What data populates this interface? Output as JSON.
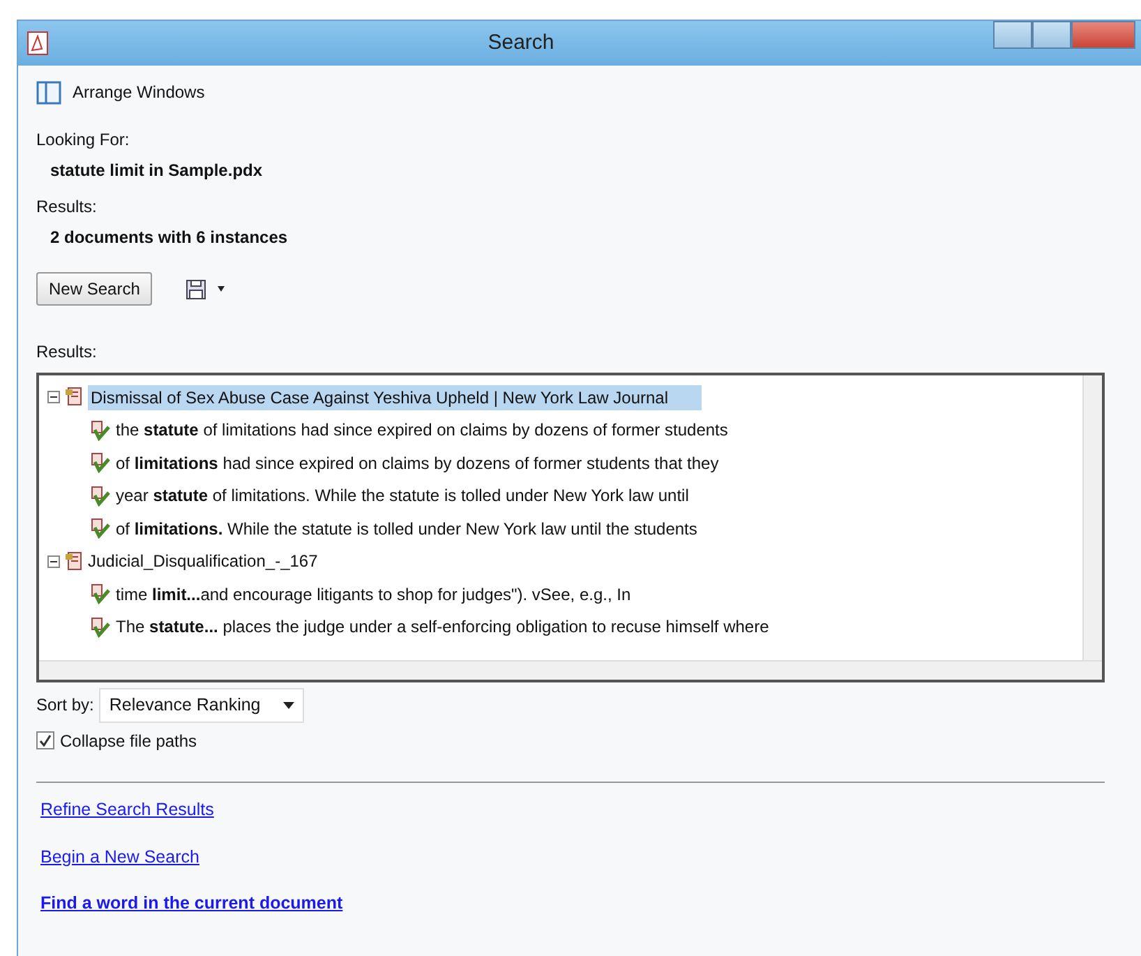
{
  "window": {
    "title": "Search"
  },
  "toolbar": {
    "arrange_label": "Arrange Windows"
  },
  "looking_for": {
    "label": "Looking For:",
    "value": "statute limit in Sample.pdx"
  },
  "summary": {
    "label": "Results:",
    "value": "2 documents with 6 instances"
  },
  "new_search_button": "New Search",
  "results_label": "Results:",
  "results": [
    {
      "title": "Dismissal of Sex Abuse Case Against Yeshiva Upheld | New York Law Journal",
      "expanded": true,
      "selected": true,
      "children": [
        {
          "text": "the **statute** of limitations had since expired on claims by dozens of former students"
        },
        {
          "text": "of **limitations** had since expired on claims by dozens of former students that they"
        },
        {
          "text": "year **statute** of limitations. While the statute is tolled under New York law until"
        },
        {
          "text": "of **limitations.** While the statute is tolled under New York law until the students"
        }
      ]
    },
    {
      "title": "Judicial_Disqualification_-_167",
      "expanded": true,
      "selected": false,
      "children": [
        {
          "text": "time **limit...**and encourage litigants to shop for judges\"). vSee, e.g., In"
        },
        {
          "text": "The **statute...** places the judge under a self-enforcing obligation to recuse himself where"
        }
      ]
    }
  ],
  "sort": {
    "label": "Sort by:",
    "value": "Relevance Ranking"
  },
  "collapse_paths": {
    "label": "Collapse file paths",
    "checked": true
  },
  "links": [
    {
      "text": "Refine Search Results",
      "bold": false
    },
    {
      "text": "Begin a New Search",
      "bold": false
    },
    {
      "text": "Find a word in the current document",
      "bold": true
    }
  ]
}
